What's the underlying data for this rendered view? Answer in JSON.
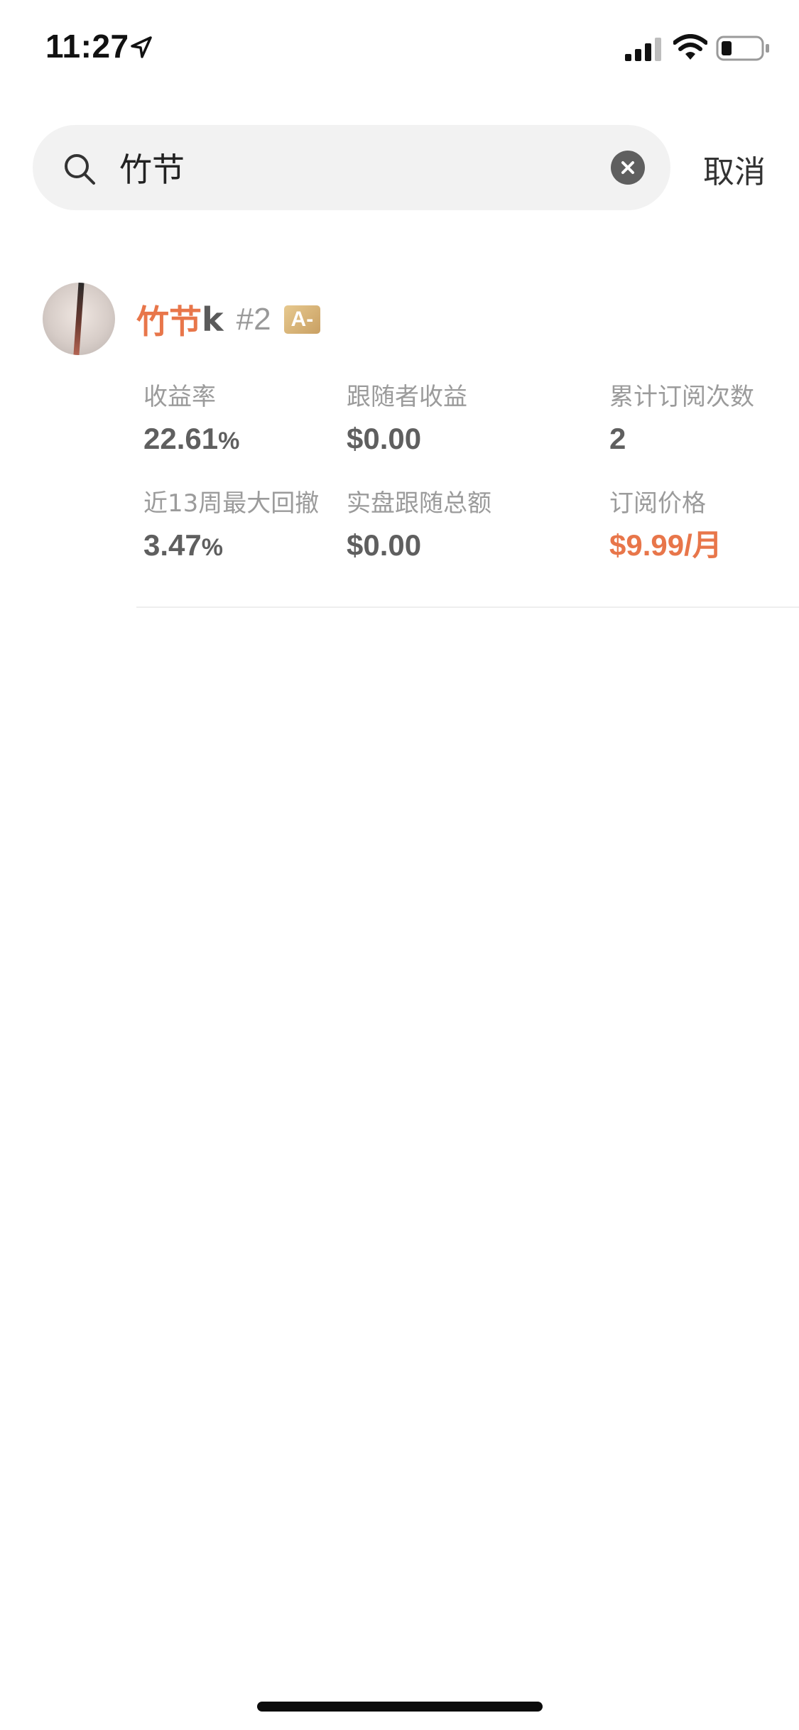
{
  "status_bar": {
    "time": "11:27"
  },
  "search": {
    "value": "竹节",
    "cancel_label": "取消"
  },
  "result": {
    "name_highlight": "竹节",
    "name_rest": "k",
    "rank": "#2",
    "grade": "A-",
    "stats": {
      "return_rate": {
        "label": "收益率",
        "value": "22.61",
        "unit": "%"
      },
      "follower_profit": {
        "label": "跟随者收益",
        "value": "$0.00"
      },
      "total_subscriptions": {
        "label": "累计订阅次数",
        "value": "2"
      },
      "max_drawdown_13w": {
        "label": "近13周最大回撤",
        "value": "3.47",
        "unit": "%"
      },
      "live_follow_total": {
        "label": "实盘跟随总额",
        "value": "$0.00"
      },
      "subscription_price": {
        "label": "订阅价格",
        "value": "$9.99/",
        "unit": "月"
      }
    }
  },
  "colors": {
    "accent": "#e8764a",
    "search_bg": "#f2f2f2",
    "label_gray": "#9b9b9b",
    "value_gray": "#5f5f5f",
    "badge_gold": "#d6b274"
  },
  "icons": {
    "location": "location-arrow-icon",
    "signal": "cellular-signal-icon",
    "wifi": "wifi-icon",
    "battery": "battery-icon",
    "search": "search-icon",
    "clear": "clear-circle-icon"
  }
}
